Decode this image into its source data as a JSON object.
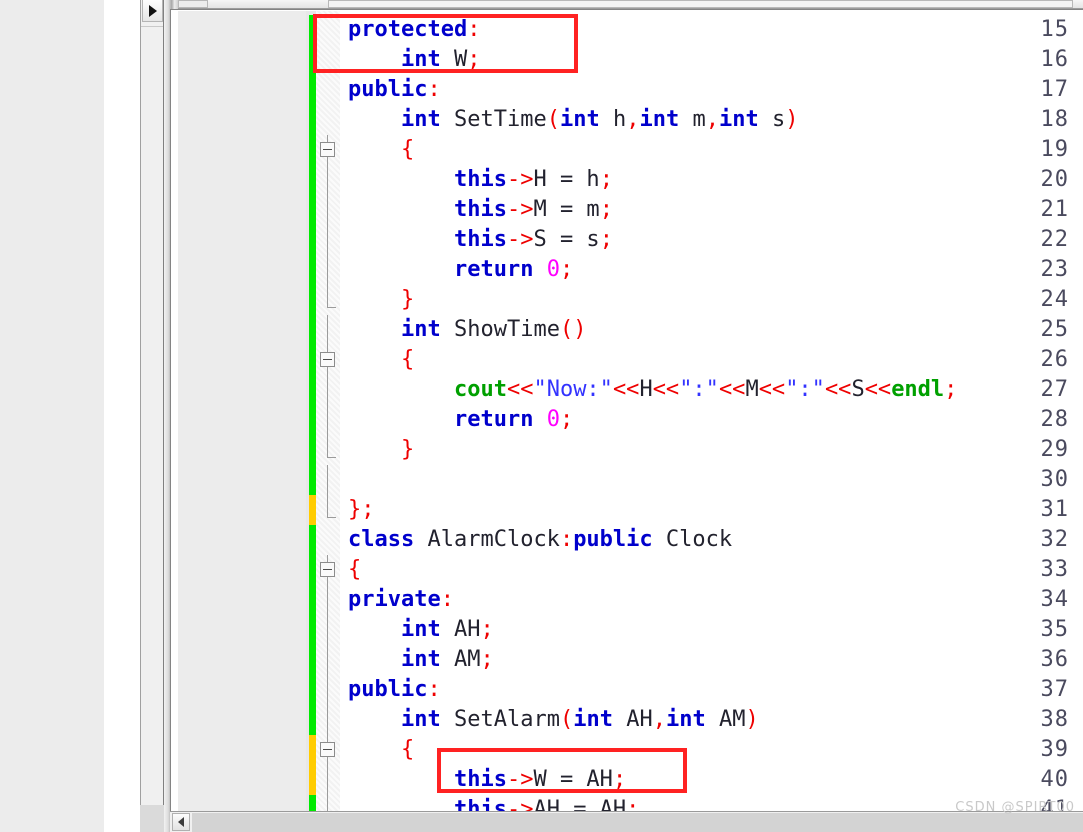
{
  "window": {
    "expand_panel_icon": "triangle-right-icon",
    "scroll_left_icon": "triangle-left-icon"
  },
  "watermark": "CSDN @SPIRT00",
  "editor": {
    "language": "C++",
    "colors": {
      "keyword": "#0000cc",
      "punctuation": "#ee0000",
      "identifier": "#22222e",
      "string": "#3333ff",
      "number": "#ff00ff",
      "stream": "#00a000",
      "line_number": "#4a4a5e",
      "gutter_bg": "#ececec",
      "code_bg": "#ffffff",
      "change_saved": "#00ea00",
      "change_unsaved": "#ffcc00",
      "annotation": "#ff2222"
    },
    "first_visible_line": 15,
    "last_visible_line": 41,
    "lines": [
      {
        "n": 15,
        "change": "saved",
        "fold": "none",
        "tokens": [
          {
            "t": "protected",
            "c": "kw"
          },
          {
            "t": ":",
            "c": "pn"
          }
        ]
      },
      {
        "n": 16,
        "change": "saved",
        "fold": "none",
        "tokens": [
          {
            "t": "    ",
            "c": "op"
          },
          {
            "t": "int",
            "c": "kw"
          },
          {
            "t": " W",
            "c": "id"
          },
          {
            "t": ";",
            "c": "pn"
          }
        ]
      },
      {
        "n": 17,
        "change": "saved",
        "fold": "none",
        "tokens": [
          {
            "t": "public",
            "c": "kw"
          },
          {
            "t": ":",
            "c": "pn"
          }
        ]
      },
      {
        "n": 18,
        "change": "saved",
        "fold": "none",
        "tokens": [
          {
            "t": "    ",
            "c": "op"
          },
          {
            "t": "int",
            "c": "kw"
          },
          {
            "t": " SetTime",
            "c": "id"
          },
          {
            "t": "(",
            "c": "pn"
          },
          {
            "t": "int",
            "c": "kw"
          },
          {
            "t": " h",
            "c": "id"
          },
          {
            "t": ",",
            "c": "pn"
          },
          {
            "t": "int",
            "c": "kw"
          },
          {
            "t": " m",
            "c": "id"
          },
          {
            "t": ",",
            "c": "pn"
          },
          {
            "t": "int",
            "c": "kw"
          },
          {
            "t": " s",
            "c": "id"
          },
          {
            "t": ")",
            "c": "pn"
          }
        ]
      },
      {
        "n": 19,
        "change": "saved",
        "fold": "box",
        "tokens": [
          {
            "t": "    ",
            "c": "op"
          },
          {
            "t": "{",
            "c": "pn"
          }
        ]
      },
      {
        "n": 20,
        "change": "saved",
        "fold": "line",
        "tokens": [
          {
            "t": "        ",
            "c": "op"
          },
          {
            "t": "this",
            "c": "kw"
          },
          {
            "t": "->",
            "c": "pn"
          },
          {
            "t": "H = h",
            "c": "id"
          },
          {
            "t": ";",
            "c": "pn"
          }
        ]
      },
      {
        "n": 21,
        "change": "saved",
        "fold": "line",
        "tokens": [
          {
            "t": "        ",
            "c": "op"
          },
          {
            "t": "this",
            "c": "kw"
          },
          {
            "t": "->",
            "c": "pn"
          },
          {
            "t": "M = m",
            "c": "id"
          },
          {
            "t": ";",
            "c": "pn"
          }
        ]
      },
      {
        "n": 22,
        "change": "saved",
        "fold": "line",
        "tokens": [
          {
            "t": "        ",
            "c": "op"
          },
          {
            "t": "this",
            "c": "kw"
          },
          {
            "t": "->",
            "c": "pn"
          },
          {
            "t": "S = s",
            "c": "id"
          },
          {
            "t": ";",
            "c": "pn"
          }
        ]
      },
      {
        "n": 23,
        "change": "saved",
        "fold": "line",
        "tokens": [
          {
            "t": "        ",
            "c": "op"
          },
          {
            "t": "return",
            "c": "kw"
          },
          {
            "t": " ",
            "c": "op"
          },
          {
            "t": "0",
            "c": "num"
          },
          {
            "t": ";",
            "c": "pn"
          }
        ]
      },
      {
        "n": 24,
        "change": "saved",
        "fold": "end",
        "tokens": [
          {
            "t": "    ",
            "c": "op"
          },
          {
            "t": "}",
            "c": "pn"
          }
        ]
      },
      {
        "n": 25,
        "change": "saved",
        "fold": "line",
        "tokens": [
          {
            "t": "    ",
            "c": "op"
          },
          {
            "t": "int",
            "c": "kw"
          },
          {
            "t": " ShowTime",
            "c": "id"
          },
          {
            "t": "()",
            "c": "pn"
          }
        ]
      },
      {
        "n": 26,
        "change": "saved",
        "fold": "box",
        "tokens": [
          {
            "t": "    ",
            "c": "op"
          },
          {
            "t": "{",
            "c": "pn"
          }
        ]
      },
      {
        "n": 27,
        "change": "saved",
        "fold": "line",
        "tokens": [
          {
            "t": "        ",
            "c": "op"
          },
          {
            "t": "cout",
            "c": "io"
          },
          {
            "t": "<<",
            "c": "pn"
          },
          {
            "t": "\"Now:\"",
            "c": "str"
          },
          {
            "t": "<<",
            "c": "pn"
          },
          {
            "t": "H",
            "c": "id"
          },
          {
            "t": "<<",
            "c": "pn"
          },
          {
            "t": "\":\"",
            "c": "str"
          },
          {
            "t": "<<",
            "c": "pn"
          },
          {
            "t": "M",
            "c": "id"
          },
          {
            "t": "<<",
            "c": "pn"
          },
          {
            "t": "\":\"",
            "c": "str"
          },
          {
            "t": "<<",
            "c": "pn"
          },
          {
            "t": "S",
            "c": "id"
          },
          {
            "t": "<<",
            "c": "pn"
          },
          {
            "t": "endl",
            "c": "io"
          },
          {
            "t": ";",
            "c": "pn"
          }
        ]
      },
      {
        "n": 28,
        "change": "saved",
        "fold": "line",
        "tokens": [
          {
            "t": "        ",
            "c": "op"
          },
          {
            "t": "return",
            "c": "kw"
          },
          {
            "t": " ",
            "c": "op"
          },
          {
            "t": "0",
            "c": "num"
          },
          {
            "t": ";",
            "c": "pn"
          }
        ]
      },
      {
        "n": 29,
        "change": "saved",
        "fold": "end",
        "tokens": [
          {
            "t": "    ",
            "c": "op"
          },
          {
            "t": "}",
            "c": "pn"
          }
        ]
      },
      {
        "n": 30,
        "change": "saved",
        "fold": "line",
        "tokens": []
      },
      {
        "n": 31,
        "change": "unsaved",
        "fold": "end",
        "tokens": [
          {
            "t": "};",
            "c": "pn"
          }
        ]
      },
      {
        "n": 32,
        "change": "saved",
        "fold": "none",
        "tokens": [
          {
            "t": "class",
            "c": "kw"
          },
          {
            "t": " AlarmClock",
            "c": "id"
          },
          {
            "t": ":",
            "c": "pn"
          },
          {
            "t": "public",
            "c": "kw"
          },
          {
            "t": " Clock",
            "c": "id"
          }
        ]
      },
      {
        "n": 33,
        "change": "saved",
        "fold": "box",
        "tokens": [
          {
            "t": "{",
            "c": "pn"
          }
        ]
      },
      {
        "n": 34,
        "change": "saved",
        "fold": "line",
        "tokens": [
          {
            "t": "private",
            "c": "kw"
          },
          {
            "t": ":",
            "c": "pn"
          }
        ]
      },
      {
        "n": 35,
        "change": "saved",
        "fold": "line",
        "tokens": [
          {
            "t": "    ",
            "c": "op"
          },
          {
            "t": "int",
            "c": "kw"
          },
          {
            "t": " AH",
            "c": "id"
          },
          {
            "t": ";",
            "c": "pn"
          }
        ]
      },
      {
        "n": 36,
        "change": "saved",
        "fold": "line",
        "tokens": [
          {
            "t": "    ",
            "c": "op"
          },
          {
            "t": "int",
            "c": "kw"
          },
          {
            "t": " AM",
            "c": "id"
          },
          {
            "t": ";",
            "c": "pn"
          }
        ]
      },
      {
        "n": 37,
        "change": "saved",
        "fold": "line",
        "tokens": [
          {
            "t": "public",
            "c": "kw"
          },
          {
            "t": ":",
            "c": "pn"
          }
        ]
      },
      {
        "n": 38,
        "change": "saved",
        "fold": "line",
        "tokens": [
          {
            "t": "    ",
            "c": "op"
          },
          {
            "t": "int",
            "c": "kw"
          },
          {
            "t": " SetAlarm",
            "c": "id"
          },
          {
            "t": "(",
            "c": "pn"
          },
          {
            "t": "int",
            "c": "kw"
          },
          {
            "t": " AH",
            "c": "id"
          },
          {
            "t": ",",
            "c": "pn"
          },
          {
            "t": "int",
            "c": "kw"
          },
          {
            "t": " AM",
            "c": "id"
          },
          {
            "t": ")",
            "c": "pn"
          }
        ]
      },
      {
        "n": 39,
        "change": "unsaved",
        "fold": "box",
        "tokens": [
          {
            "t": "    ",
            "c": "op"
          },
          {
            "t": "{",
            "c": "pn"
          }
        ]
      },
      {
        "n": 40,
        "change": "unsaved",
        "fold": "line",
        "tokens": [
          {
            "t": "        ",
            "c": "op"
          },
          {
            "t": "this",
            "c": "kw"
          },
          {
            "t": "->",
            "c": "pn"
          },
          {
            "t": "W = AH",
            "c": "id"
          },
          {
            "t": ";",
            "c": "pn"
          }
        ]
      },
      {
        "n": 41,
        "change": "saved",
        "fold": "line",
        "tokens": [
          {
            "t": "        ",
            "c": "op"
          },
          {
            "t": "this",
            "c": "kw"
          },
          {
            "t": "->",
            "c": "pn"
          },
          {
            "t": "AH = AH",
            "c": "id"
          },
          {
            "t": ";",
            "c": "pn"
          }
        ]
      }
    ],
    "annotations": [
      {
        "label": "highlight-protected-int-w",
        "lines": [
          15,
          16
        ]
      },
      {
        "label": "highlight-this-w-assign",
        "lines": [
          40
        ]
      }
    ]
  }
}
